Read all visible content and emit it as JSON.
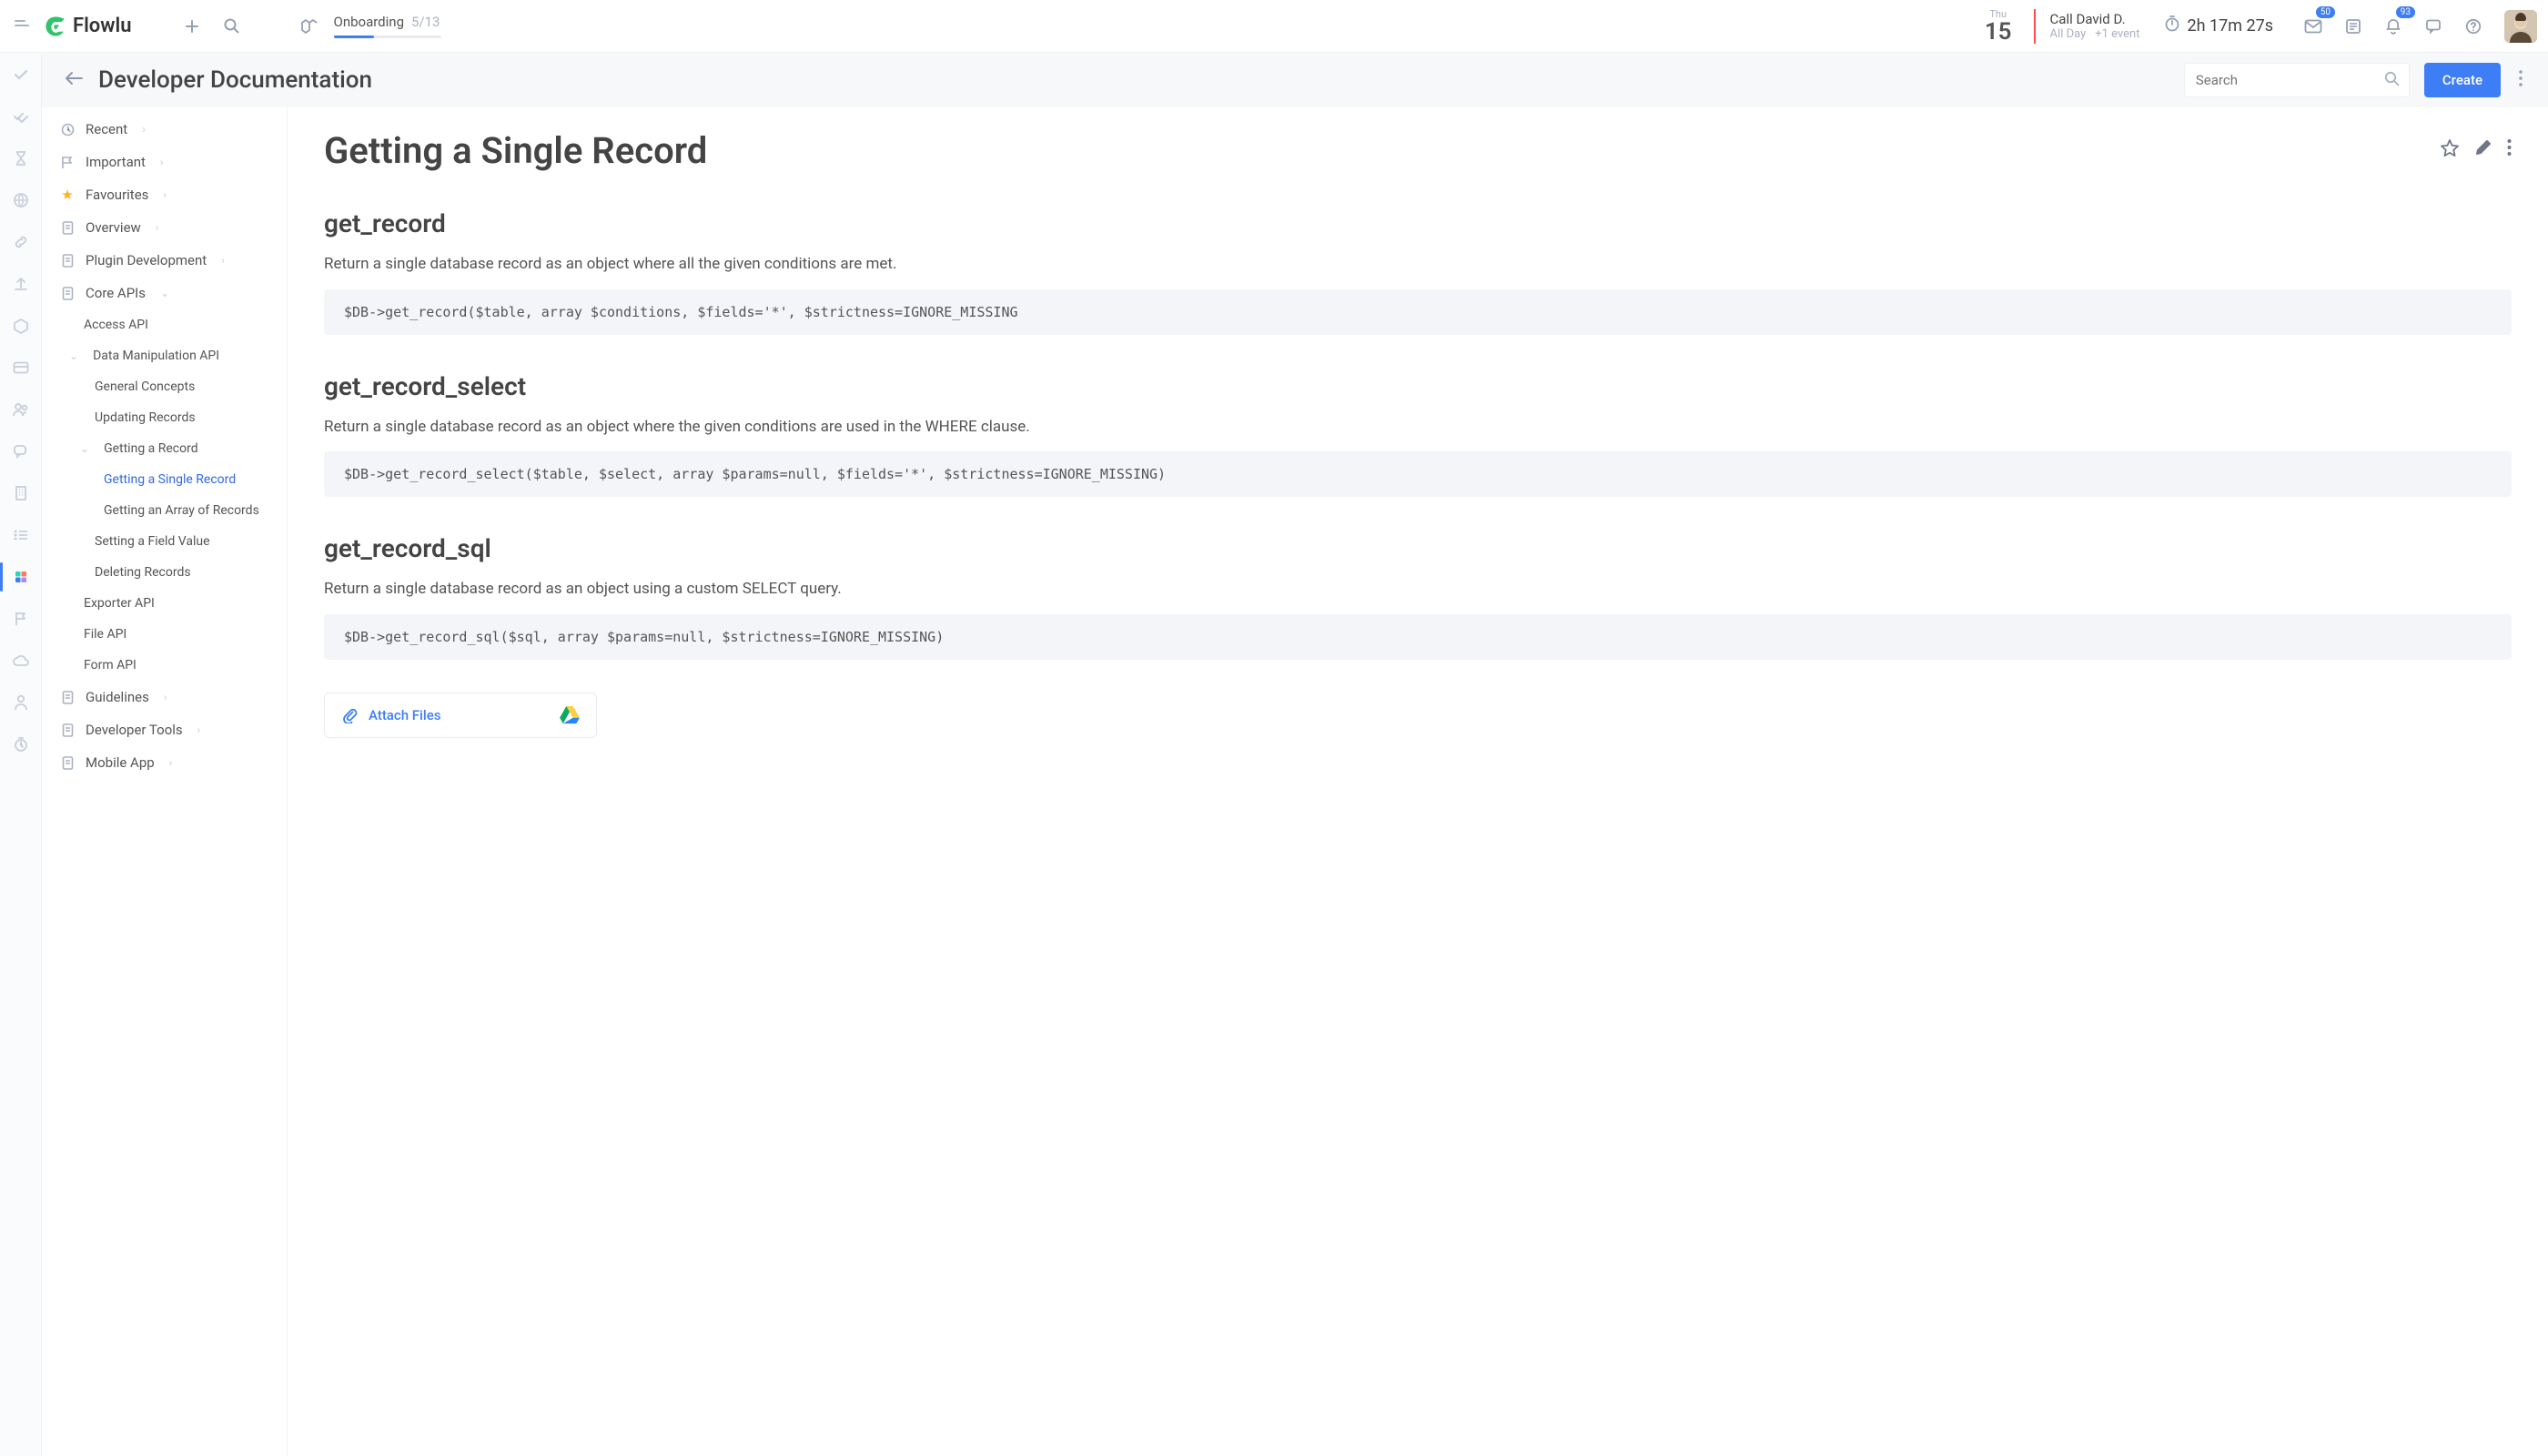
{
  "topbar": {
    "logo_text": "Flowlu",
    "onboarding": {
      "label": "Onboarding",
      "count": "5/13",
      "progress_pct": 38
    },
    "date": {
      "dow": "Thu",
      "day": "15"
    },
    "event": {
      "title": "Call David D.",
      "allday": "All Day",
      "more": "+1 event"
    },
    "timer": "2h 17m 27s",
    "inbox_badge": "50",
    "bell_badge": "93"
  },
  "header": {
    "title": "Developer Documentation",
    "search_placeholder": "Search",
    "create_label": "Create"
  },
  "sidebar": {
    "recent": "Recent",
    "important": "Important",
    "favourites": "Favourites",
    "overview": "Overview",
    "plugin_dev": "Plugin Development",
    "core_apis": "Core APIs",
    "access_api": "Access API",
    "dm_api": "Data Manipulation API",
    "gen_concepts": "General Concepts",
    "updating": "Updating Records",
    "getting_record": "Getting a Record",
    "single_record": "Getting a Single Record",
    "array_records": "Getting an Array of Records",
    "set_field": "Setting a Field Value",
    "deleting": "Deleting Records",
    "exporter": "Exporter API",
    "file_api": "File API",
    "form_api": "Form API",
    "guidelines": "Guidelines",
    "dev_tools": "Developer Tools",
    "mobile_app": "Mobile App"
  },
  "doc": {
    "title": "Getting a Single Record",
    "sections": [
      {
        "heading": "get_record",
        "desc": "Return a single database record as an object where all the given conditions are met.",
        "code": "$DB->get_record($table, array $conditions, $fields='*', $strictness=IGNORE_MISSING"
      },
      {
        "heading": "get_record_select",
        "desc": "Return a single database record as an object where the given conditions are used in the WHERE clause.",
        "code": "$DB->get_record_select($table, $select, array $params=null, $fields='*', $strictness=IGNORE_MISSING)"
      },
      {
        "heading": "get_record_sql",
        "desc": "Return a single database record as an object using a custom SELECT query.",
        "code": "$DB->get_record_sql($sql, array $params=null, $strictness=IGNORE_MISSING)"
      }
    ],
    "attach_label": "Attach Files"
  }
}
